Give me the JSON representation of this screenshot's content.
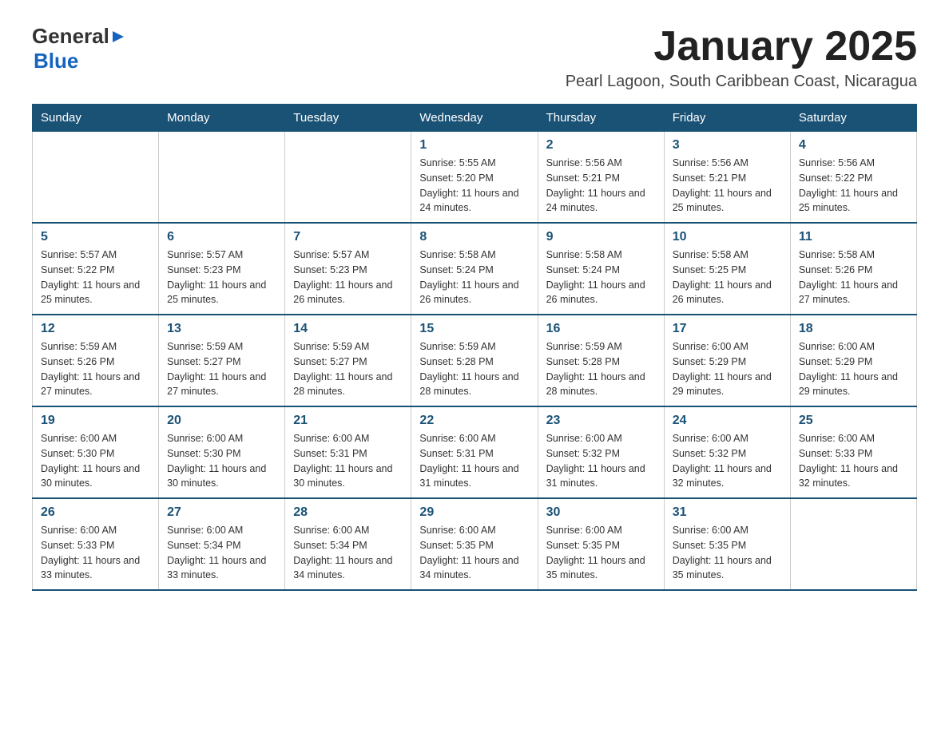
{
  "logo": {
    "general": "General",
    "blue": "Blue"
  },
  "title": "January 2025",
  "subtitle": "Pearl Lagoon, South Caribbean Coast, Nicaragua",
  "weekdays": [
    "Sunday",
    "Monday",
    "Tuesday",
    "Wednesday",
    "Thursday",
    "Friday",
    "Saturday"
  ],
  "weeks": [
    [
      {
        "day": "",
        "info": ""
      },
      {
        "day": "",
        "info": ""
      },
      {
        "day": "",
        "info": ""
      },
      {
        "day": "1",
        "info": "Sunrise: 5:55 AM\nSunset: 5:20 PM\nDaylight: 11 hours and 24 minutes."
      },
      {
        "day": "2",
        "info": "Sunrise: 5:56 AM\nSunset: 5:21 PM\nDaylight: 11 hours and 24 minutes."
      },
      {
        "day": "3",
        "info": "Sunrise: 5:56 AM\nSunset: 5:21 PM\nDaylight: 11 hours and 25 minutes."
      },
      {
        "day": "4",
        "info": "Sunrise: 5:56 AM\nSunset: 5:22 PM\nDaylight: 11 hours and 25 minutes."
      }
    ],
    [
      {
        "day": "5",
        "info": "Sunrise: 5:57 AM\nSunset: 5:22 PM\nDaylight: 11 hours and 25 minutes."
      },
      {
        "day": "6",
        "info": "Sunrise: 5:57 AM\nSunset: 5:23 PM\nDaylight: 11 hours and 25 minutes."
      },
      {
        "day": "7",
        "info": "Sunrise: 5:57 AM\nSunset: 5:23 PM\nDaylight: 11 hours and 26 minutes."
      },
      {
        "day": "8",
        "info": "Sunrise: 5:58 AM\nSunset: 5:24 PM\nDaylight: 11 hours and 26 minutes."
      },
      {
        "day": "9",
        "info": "Sunrise: 5:58 AM\nSunset: 5:24 PM\nDaylight: 11 hours and 26 minutes."
      },
      {
        "day": "10",
        "info": "Sunrise: 5:58 AM\nSunset: 5:25 PM\nDaylight: 11 hours and 26 minutes."
      },
      {
        "day": "11",
        "info": "Sunrise: 5:58 AM\nSunset: 5:26 PM\nDaylight: 11 hours and 27 minutes."
      }
    ],
    [
      {
        "day": "12",
        "info": "Sunrise: 5:59 AM\nSunset: 5:26 PM\nDaylight: 11 hours and 27 minutes."
      },
      {
        "day": "13",
        "info": "Sunrise: 5:59 AM\nSunset: 5:27 PM\nDaylight: 11 hours and 27 minutes."
      },
      {
        "day": "14",
        "info": "Sunrise: 5:59 AM\nSunset: 5:27 PM\nDaylight: 11 hours and 28 minutes."
      },
      {
        "day": "15",
        "info": "Sunrise: 5:59 AM\nSunset: 5:28 PM\nDaylight: 11 hours and 28 minutes."
      },
      {
        "day": "16",
        "info": "Sunrise: 5:59 AM\nSunset: 5:28 PM\nDaylight: 11 hours and 28 minutes."
      },
      {
        "day": "17",
        "info": "Sunrise: 6:00 AM\nSunset: 5:29 PM\nDaylight: 11 hours and 29 minutes."
      },
      {
        "day": "18",
        "info": "Sunrise: 6:00 AM\nSunset: 5:29 PM\nDaylight: 11 hours and 29 minutes."
      }
    ],
    [
      {
        "day": "19",
        "info": "Sunrise: 6:00 AM\nSunset: 5:30 PM\nDaylight: 11 hours and 30 minutes."
      },
      {
        "day": "20",
        "info": "Sunrise: 6:00 AM\nSunset: 5:30 PM\nDaylight: 11 hours and 30 minutes."
      },
      {
        "day": "21",
        "info": "Sunrise: 6:00 AM\nSunset: 5:31 PM\nDaylight: 11 hours and 30 minutes."
      },
      {
        "day": "22",
        "info": "Sunrise: 6:00 AM\nSunset: 5:31 PM\nDaylight: 11 hours and 31 minutes."
      },
      {
        "day": "23",
        "info": "Sunrise: 6:00 AM\nSunset: 5:32 PM\nDaylight: 11 hours and 31 minutes."
      },
      {
        "day": "24",
        "info": "Sunrise: 6:00 AM\nSunset: 5:32 PM\nDaylight: 11 hours and 32 minutes."
      },
      {
        "day": "25",
        "info": "Sunrise: 6:00 AM\nSunset: 5:33 PM\nDaylight: 11 hours and 32 minutes."
      }
    ],
    [
      {
        "day": "26",
        "info": "Sunrise: 6:00 AM\nSunset: 5:33 PM\nDaylight: 11 hours and 33 minutes."
      },
      {
        "day": "27",
        "info": "Sunrise: 6:00 AM\nSunset: 5:34 PM\nDaylight: 11 hours and 33 minutes."
      },
      {
        "day": "28",
        "info": "Sunrise: 6:00 AM\nSunset: 5:34 PM\nDaylight: 11 hours and 34 minutes."
      },
      {
        "day": "29",
        "info": "Sunrise: 6:00 AM\nSunset: 5:35 PM\nDaylight: 11 hours and 34 minutes."
      },
      {
        "day": "30",
        "info": "Sunrise: 6:00 AM\nSunset: 5:35 PM\nDaylight: 11 hours and 35 minutes."
      },
      {
        "day": "31",
        "info": "Sunrise: 6:00 AM\nSunset: 5:35 PM\nDaylight: 11 hours and 35 minutes."
      },
      {
        "day": "",
        "info": ""
      }
    ]
  ]
}
